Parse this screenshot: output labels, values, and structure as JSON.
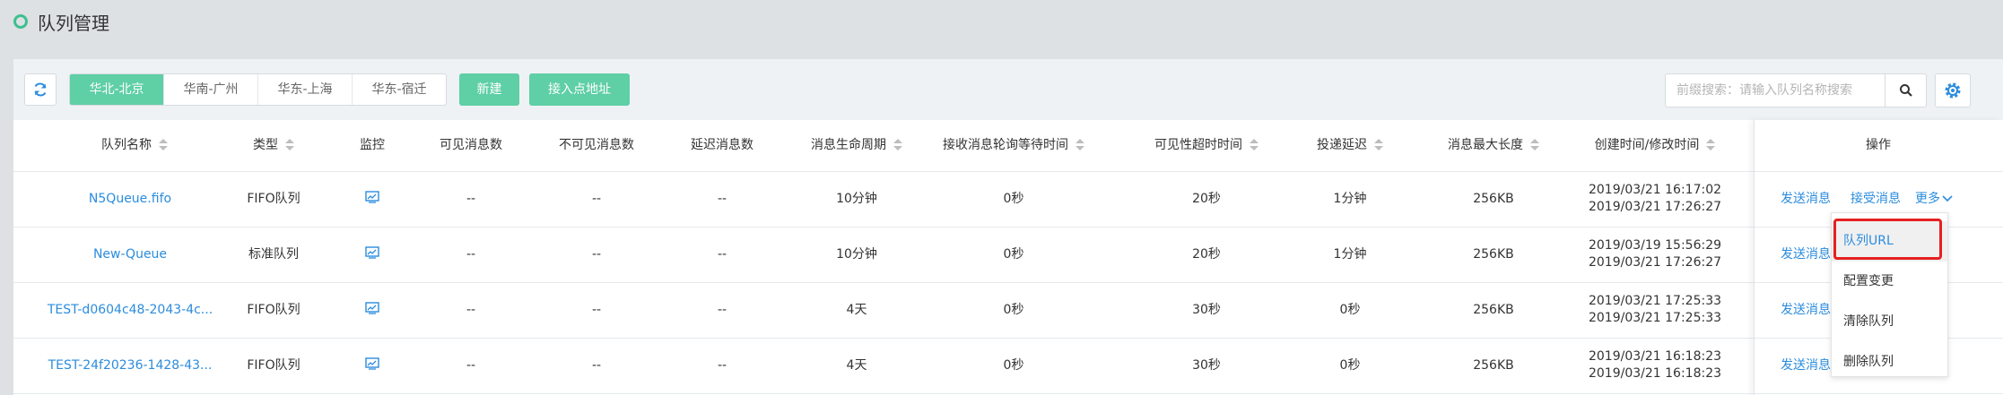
{
  "page": {
    "title": "队列管理"
  },
  "toolbar": {
    "regions": [
      "华北-北京",
      "华南-广州",
      "华东-上海",
      "华东-宿迁"
    ],
    "active_region": 0,
    "new_label": "新建",
    "endpoint_label": "接入点地址",
    "search_placeholder": "前缀搜索：请输入队列名称搜索"
  },
  "table": {
    "headers": {
      "name": "队列名称",
      "type": "类型",
      "monitor": "监控",
      "visible": "可见消息数",
      "invisible": "不可见消息数",
      "delayed": "延迟消息数",
      "lifecycle": "消息生命周期",
      "polling": "接收消息轮询等待时间",
      "visibility_timeout": "可见性超时时间",
      "delivery_delay": "投递延迟",
      "max_length": "消息最大长度",
      "time": "创建时间/修改时间",
      "ops": "操作"
    },
    "rows": [
      {
        "name": "N5Queue.fifo",
        "type": "FIFO队列",
        "visible": "--",
        "invisible": "--",
        "delayed": "--",
        "lifecycle": "10分钟",
        "polling": "0秒",
        "visibility_timeout": "20秒",
        "delivery_delay": "1分钟",
        "max_length": "256KB",
        "created": "2019/03/21 16:17:02",
        "modified": "2019/03/21 17:26:27"
      },
      {
        "name": "New-Queue",
        "type": "标准队列",
        "visible": "--",
        "invisible": "--",
        "delayed": "--",
        "lifecycle": "10分钟",
        "polling": "0秒",
        "visibility_timeout": "20秒",
        "delivery_delay": "1分钟",
        "max_length": "256KB",
        "created": "2019/03/19 15:56:29",
        "modified": "2019/03/21 17:26:27"
      },
      {
        "name": "TEST-d0604c48-2043-4c...",
        "type": "FIFO队列",
        "visible": "--",
        "invisible": "--",
        "delayed": "--",
        "lifecycle": "4天",
        "polling": "0秒",
        "visibility_timeout": "30秒",
        "delivery_delay": "0秒",
        "max_length": "256KB",
        "created": "2019/03/21 17:25:33",
        "modified": "2019/03/21 17:25:33"
      },
      {
        "name": "TEST-24f20236-1428-43...",
        "type": "FIFO队列",
        "visible": "--",
        "invisible": "--",
        "delayed": "--",
        "lifecycle": "4天",
        "polling": "0秒",
        "visibility_timeout": "30秒",
        "delivery_delay": "0秒",
        "max_length": "256KB",
        "created": "2019/03/21 16:18:23",
        "modified": "2019/03/21 16:18:23"
      }
    ],
    "ops": {
      "send": "发送消息",
      "receive": "接受消息",
      "more": "更多"
    }
  },
  "dropdown": {
    "items": [
      "队列URL",
      "配置变更",
      "清除队列",
      "删除队列"
    ]
  },
  "colors": {
    "accent_green": "#5fcfa5",
    "link_blue": "#2b8cde",
    "highlight_red": "#e62020"
  },
  "icons": {
    "refresh": "refresh-icon",
    "search": "search-icon",
    "settings": "gear-icon",
    "monitor": "chart-icon",
    "chevron": "chevron-down-icon"
  }
}
